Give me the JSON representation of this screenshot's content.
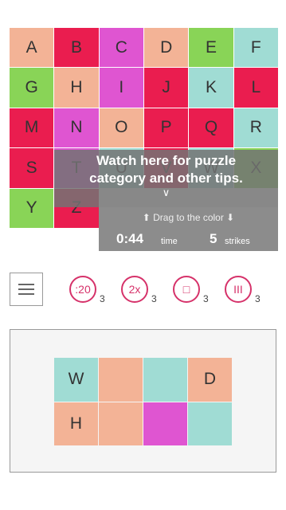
{
  "grid": [
    {
      "letter": "A",
      "color": "#f3b396"
    },
    {
      "letter": "B",
      "color": "#ea1d4f"
    },
    {
      "letter": "C",
      "color": "#df55d1"
    },
    {
      "letter": "D",
      "color": "#f3b396"
    },
    {
      "letter": "E",
      "color": "#89d457"
    },
    {
      "letter": "F",
      "color": "#a0dcd4"
    },
    {
      "letter": "G",
      "color": "#89d457"
    },
    {
      "letter": "H",
      "color": "#f3b396"
    },
    {
      "letter": "I",
      "color": "#df55d1"
    },
    {
      "letter": "J",
      "color": "#ea1d4f"
    },
    {
      "letter": "K",
      "color": "#a0dcd4"
    },
    {
      "letter": "L",
      "color": "#ea1d4f"
    },
    {
      "letter": "M",
      "color": "#ea1d4f"
    },
    {
      "letter": "N",
      "color": "#df55d1"
    },
    {
      "letter": "O",
      "color": "#f3b396"
    },
    {
      "letter": "P",
      "color": "#ea1d4f"
    },
    {
      "letter": "Q",
      "color": "#ea1d4f"
    },
    {
      "letter": "R",
      "color": "#a0dcd4"
    },
    {
      "letter": "S",
      "color": "#ea1d4f"
    },
    {
      "letter": "T",
      "color": "#df55d1"
    },
    {
      "letter": "U",
      "color": "#a0dcd4"
    },
    {
      "letter": "V",
      "color": "#ea1d4f"
    },
    {
      "letter": "W",
      "color": "#a0dcd4"
    },
    {
      "letter": "X",
      "color": "#89d457"
    },
    {
      "letter": "Y",
      "color": "#89d457"
    },
    {
      "letter": "Z",
      "color": "#ea1d4f"
    },
    {
      "letter": "",
      "color": "#ffffff"
    },
    {
      "letter": "",
      "color": "#ffffff"
    },
    {
      "letter": "",
      "color": "#ffffff"
    },
    {
      "letter": "",
      "color": "#ffffff"
    }
  ],
  "tip": {
    "line1": "Watch here for puzzle",
    "line2": "category and other tips.",
    "arrow": "∨"
  },
  "stats": {
    "hint": "⬆ Drag to the color ⬇",
    "time": "0:44",
    "time_label": "time",
    "strikes": "5",
    "strikes_label": "strikes"
  },
  "powerups": [
    {
      "label": ":20",
      "count": "3"
    },
    {
      "label": "2x",
      "count": "3"
    },
    {
      "label": "□",
      "count": "3"
    },
    {
      "label": "III",
      "count": "3"
    }
  ],
  "board_cells": [
    {
      "letter": "W",
      "color": "#a0dcd4"
    },
    {
      "letter": "",
      "color": "#f3b396"
    },
    {
      "letter": "",
      "color": "#a0dcd4"
    },
    {
      "letter": "D",
      "color": "#f3b396"
    },
    {
      "letter": "H",
      "color": "#f3b396"
    },
    {
      "letter": "",
      "color": "#f3b396"
    },
    {
      "letter": "",
      "color": "#df55d1"
    },
    {
      "letter": "",
      "color": "#a0dcd4"
    }
  ],
  "colors": {
    "accent": "#d6326a",
    "overlay": "#737373"
  }
}
